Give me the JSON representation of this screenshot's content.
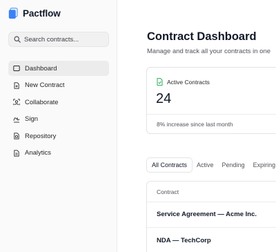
{
  "app": {
    "name": "Pactflow",
    "accent": "#3b82f6"
  },
  "search": {
    "placeholder": "Search contracts..."
  },
  "sidebar": {
    "items": [
      {
        "label": "Dashboard",
        "icon": "dashboard-icon",
        "active": true
      },
      {
        "label": "New Contract",
        "icon": "file-plus-icon",
        "active": false
      },
      {
        "label": "Collaborate",
        "icon": "users-icon",
        "active": false
      },
      {
        "label": "Sign",
        "icon": "signature-icon",
        "active": false
      },
      {
        "label": "Repository",
        "icon": "archive-icon",
        "active": false
      },
      {
        "label": "Analytics",
        "icon": "report-icon",
        "active": false
      }
    ]
  },
  "header": {
    "title": "Contract Dashboard",
    "subtitle": "Manage and track all your contracts in one"
  },
  "stat_card": {
    "label": "Active Contracts",
    "icon": "file-check-icon",
    "value": "24",
    "footer": "8% increase since last month",
    "icon_color": "#16a34a"
  },
  "tabs": [
    {
      "label": "All Contracts",
      "active": true
    },
    {
      "label": "Active",
      "active": false
    },
    {
      "label": "Pending",
      "active": false
    },
    {
      "label": "Expiring",
      "active": false
    }
  ],
  "table": {
    "columns": [
      "Contract"
    ],
    "rows": [
      {
        "contract": "Service Agreement — Acme Inc."
      },
      {
        "contract": "NDA — TechCorp"
      }
    ]
  }
}
